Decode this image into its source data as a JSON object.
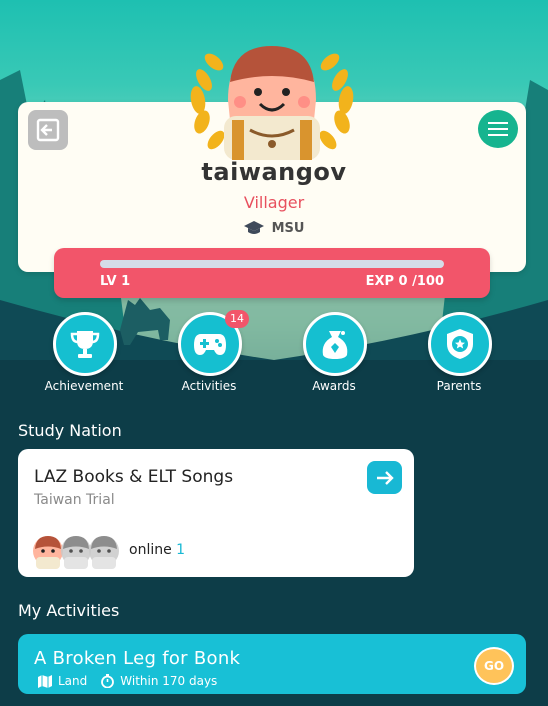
{
  "profile": {
    "username": "taiwangov",
    "rank": "Villager",
    "school": "MSU",
    "level_label": "LV 1",
    "exp_label": "EXP 0 /100",
    "exp_progress": 0.0
  },
  "nav": [
    {
      "label": "Achievement",
      "icon": "trophy-icon"
    },
    {
      "label": "Activities",
      "icon": "gamepad-icon",
      "badge": "14"
    },
    {
      "label": "Awards",
      "icon": "gift-bag-icon"
    },
    {
      "label": "Parents",
      "icon": "shield-star-icon"
    }
  ],
  "study_nation": {
    "section_title": "Study Nation",
    "card_title": "LAZ Books & ELT Songs",
    "card_subtitle": "Taiwan Trial",
    "online_label": "online",
    "online_count": "1"
  },
  "my_activities": {
    "section_title": "My Activities",
    "title": "A Broken Leg for Bonk",
    "type": "Land",
    "deadline": "Within 170 days",
    "go_label": "GO"
  },
  "colors": {
    "accent_teal": "#18c0d6",
    "level_bar": "#f2556a",
    "menu_green": "#16b48f",
    "go_yellow": "#ffc35a"
  }
}
